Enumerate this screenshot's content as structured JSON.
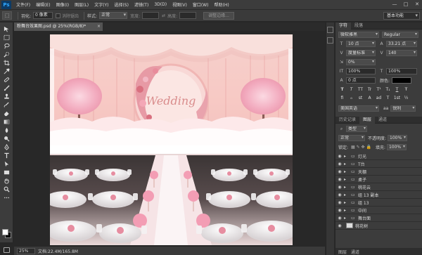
{
  "app": {
    "logo": "Ps"
  },
  "menu": [
    "文件(F)",
    "编辑(E)",
    "图像(I)",
    "图层(L)",
    "文字(Y)",
    "选择(S)",
    "滤镜(T)",
    "3D(D)",
    "视图(V)",
    "窗口(W)",
    "帮助(H)"
  ],
  "window_controls": [
    "—",
    "□",
    "✕"
  ],
  "options": {
    "feather_label": "羽化:",
    "feather_value": "0 像素",
    "antialias_label": "消除锯齿",
    "style_label": "样式:",
    "style_value": "正常",
    "width_label": "宽度:",
    "height_label": "高度:",
    "refine_button": "调整边缘...",
    "workspace": "基本功能"
  },
  "document": {
    "tab_title": "粉舞台效果图.psd @ 25%(RGB/8)*",
    "close": "×"
  },
  "canvas_art": {
    "wedding_text": "Wedding"
  },
  "status": {
    "zoom": "25%",
    "doc_info": "文档:22.4M/165.8M"
  },
  "character": {
    "tabs": [
      "字符",
      "段落"
    ],
    "font_family": "微软雅黑",
    "font_style": "Regular",
    "font_size": "10 点",
    "leading": "33.21 点",
    "kerning": "度量标准",
    "tracking": "140",
    "baseline_pct": "0%",
    "vscale": "100%",
    "hscale": "100%",
    "baseline_shift": "0 点",
    "color_label": "颜色:",
    "language": "美国英语",
    "aa_label": "aa",
    "aa_value": "锐利",
    "format_buttons": [
      "T",
      "T",
      "TT",
      "Tr",
      "T¹",
      "T₁",
      "T",
      "Ŧ"
    ],
    "ot_buttons": [
      "fi",
      "ℴ",
      "st",
      "A",
      "ad",
      "T",
      "1st",
      "½"
    ]
  },
  "layers": {
    "tabs": [
      "历史记录",
      "图层",
      "通道"
    ],
    "filter_label": "类型",
    "blend_mode": "正常",
    "opacity_label": "不透明度:",
    "opacity_value": "100%",
    "lock_label": "锁定:",
    "fill_label": "填充:",
    "fill_value": "100%",
    "items": [
      {
        "name": "灯光",
        "type": "folder"
      },
      {
        "name": "T台",
        "type": "folder"
      },
      {
        "name": "天棚",
        "type": "folder"
      },
      {
        "name": "桌子",
        "type": "folder"
      },
      {
        "name": "桃花云",
        "type": "folder"
      },
      {
        "name": "组 13 副本",
        "type": "folder"
      },
      {
        "name": "组 13",
        "type": "folder"
      },
      {
        "name": "中间",
        "type": "folder"
      },
      {
        "name": "舞台面",
        "type": "folder"
      },
      {
        "name": "桃花树",
        "type": "layer"
      }
    ],
    "bottom_tabs": [
      "图层",
      "通道"
    ]
  },
  "colors": {
    "foreground": "#ffffff",
    "background": "#000000",
    "accent": "#f3c2c5"
  }
}
